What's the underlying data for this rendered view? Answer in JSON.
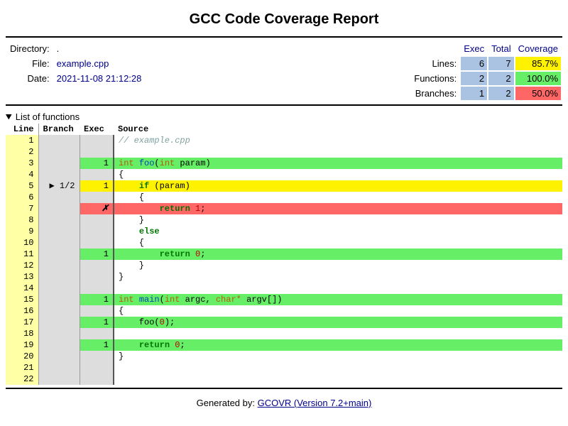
{
  "title": "GCC Code Coverage Report",
  "meta": {
    "directory_label": "Directory:",
    "directory_value": ".",
    "file_label": "File:",
    "file_value": "example.cpp",
    "date_label": "Date:",
    "date_value": "2021-11-08 21:12:28"
  },
  "coverage_header": {
    "exec": "Exec",
    "total": "Total",
    "coverage": "Coverage"
  },
  "coverage": {
    "lines_label": "Lines:",
    "lines_exec": "6",
    "lines_total": "7",
    "lines_pct": "85.7%",
    "lines_color": "yellow",
    "funcs_label": "Functions:",
    "funcs_exec": "2",
    "funcs_total": "2",
    "funcs_pct": "100.0%",
    "funcs_color": "green",
    "branches_label": "Branches:",
    "branches_exec": "1",
    "branches_total": "2",
    "branches_pct": "50.0%",
    "branches_color": "red"
  },
  "details_summary": "List of functions",
  "columns": {
    "line": "Line",
    "branch": "Branch",
    "exec": "Exec",
    "source": "Source"
  },
  "source": [
    {
      "n": 1,
      "branch": "",
      "exec": "",
      "row": "",
      "tokens": [
        [
          "com",
          "// example.cpp"
        ]
      ]
    },
    {
      "n": 2,
      "branch": "",
      "exec": "",
      "row": "",
      "tokens": []
    },
    {
      "n": 3,
      "branch": "",
      "exec": "1",
      "row": "green",
      "tokens": [
        [
          "type",
          "int"
        ],
        [
          "",
          " "
        ],
        [
          "fn",
          "foo"
        ],
        [
          "",
          "("
        ],
        [
          "type",
          "int"
        ],
        [
          "",
          " param)"
        ]
      ]
    },
    {
      "n": 4,
      "branch": "",
      "exec": "",
      "row": "",
      "tokens": [
        [
          "",
          "{"
        ]
      ]
    },
    {
      "n": 5,
      "branch": "▶ 1/2",
      "exec": "1",
      "row": "yellow",
      "tokens": [
        [
          "",
          "    "
        ],
        [
          "kw",
          "if"
        ],
        [
          "",
          " (param)"
        ]
      ]
    },
    {
      "n": 6,
      "branch": "",
      "exec": "",
      "row": "",
      "tokens": [
        [
          "",
          "    {"
        ]
      ]
    },
    {
      "n": 7,
      "branch": "",
      "exec": "✗",
      "row": "red",
      "tokens": [
        [
          "",
          "        "
        ],
        [
          "kw",
          "return"
        ],
        [
          "",
          " "
        ],
        [
          "num",
          "1"
        ],
        [
          "",
          ";"
        ]
      ]
    },
    {
      "n": 8,
      "branch": "",
      "exec": "",
      "row": "",
      "tokens": [
        [
          "",
          "    }"
        ]
      ]
    },
    {
      "n": 9,
      "branch": "",
      "exec": "",
      "row": "",
      "tokens": [
        [
          "",
          "    "
        ],
        [
          "kw",
          "else"
        ]
      ]
    },
    {
      "n": 10,
      "branch": "",
      "exec": "",
      "row": "",
      "tokens": [
        [
          "",
          "    {"
        ]
      ]
    },
    {
      "n": 11,
      "branch": "",
      "exec": "1",
      "row": "green",
      "tokens": [
        [
          "",
          "        "
        ],
        [
          "kw",
          "return"
        ],
        [
          "",
          " "
        ],
        [
          "num",
          "0"
        ],
        [
          "",
          ";"
        ]
      ]
    },
    {
      "n": 12,
      "branch": "",
      "exec": "",
      "row": "",
      "tokens": [
        [
          "",
          "    }"
        ]
      ]
    },
    {
      "n": 13,
      "branch": "",
      "exec": "",
      "row": "",
      "tokens": [
        [
          "",
          "}"
        ]
      ]
    },
    {
      "n": 14,
      "branch": "",
      "exec": "",
      "row": "",
      "tokens": []
    },
    {
      "n": 15,
      "branch": "",
      "exec": "1",
      "row": "green",
      "tokens": [
        [
          "type",
          "int"
        ],
        [
          "",
          " "
        ],
        [
          "fn",
          "main"
        ],
        [
          "",
          "("
        ],
        [
          "type",
          "int"
        ],
        [
          "",
          " argc, "
        ],
        [
          "type",
          "char*"
        ],
        [
          "",
          " argv[])"
        ]
      ]
    },
    {
      "n": 16,
      "branch": "",
      "exec": "",
      "row": "",
      "tokens": [
        [
          "",
          "{"
        ]
      ]
    },
    {
      "n": 17,
      "branch": "",
      "exec": "1",
      "row": "green",
      "tokens": [
        [
          "",
          "    foo("
        ],
        [
          "num",
          "0"
        ],
        [
          "",
          ");"
        ]
      ]
    },
    {
      "n": 18,
      "branch": "",
      "exec": "",
      "row": "",
      "tokens": []
    },
    {
      "n": 19,
      "branch": "",
      "exec": "1",
      "row": "green",
      "tokens": [
        [
          "",
          "    "
        ],
        [
          "kw",
          "return"
        ],
        [
          "",
          " "
        ],
        [
          "num",
          "0"
        ],
        [
          "",
          ";"
        ]
      ]
    },
    {
      "n": 20,
      "branch": "",
      "exec": "",
      "row": "",
      "tokens": [
        [
          "",
          "}"
        ]
      ]
    },
    {
      "n": 21,
      "branch": "",
      "exec": "",
      "row": "",
      "tokens": []
    },
    {
      "n": 22,
      "branch": "",
      "exec": "",
      "row": "",
      "tokens": []
    }
  ],
  "footer": {
    "label": "Generated by: ",
    "link": "GCOVR (Version 7.2+main)"
  }
}
